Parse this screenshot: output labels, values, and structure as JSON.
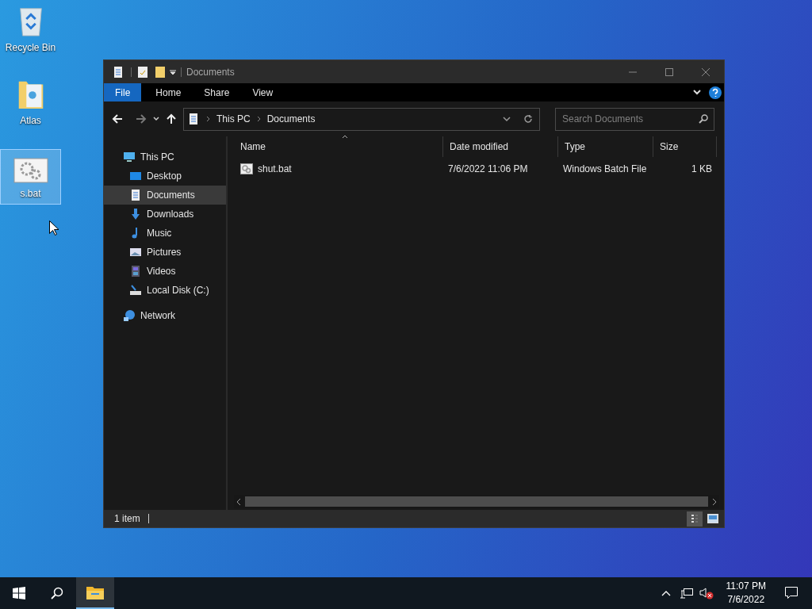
{
  "desktop_icons": [
    {
      "label": "Recycle Bin",
      "kind": "recycle",
      "selected": false
    },
    {
      "label": "Atlas",
      "kind": "folder",
      "selected": false
    },
    {
      "label": "s.bat",
      "kind": "batch",
      "selected": true
    }
  ],
  "window": {
    "title": "Documents",
    "ribbon_tabs": [
      {
        "label": "File",
        "selected": true
      },
      {
        "label": "Home",
        "selected": false
      },
      {
        "label": "Share",
        "selected": false
      },
      {
        "label": "View",
        "selected": false
      }
    ],
    "address": [
      "This PC",
      "Documents"
    ],
    "search": {
      "placeholder": "Search Documents"
    },
    "nav": [
      {
        "label": "This PC",
        "kind": "pc",
        "selected": false,
        "children": [
          {
            "label": "Desktop",
            "kind": "desktop",
            "selected": false
          },
          {
            "label": "Documents",
            "kind": "documents",
            "selected": true
          },
          {
            "label": "Downloads",
            "kind": "downloads",
            "selected": false
          },
          {
            "label": "Music",
            "kind": "music",
            "selected": false
          },
          {
            "label": "Pictures",
            "kind": "pictures",
            "selected": false
          },
          {
            "label": "Videos",
            "kind": "videos",
            "selected": false
          },
          {
            "label": "Local Disk (C:)",
            "kind": "disk",
            "selected": false
          }
        ]
      },
      {
        "label": "Network",
        "kind": "network",
        "selected": false
      }
    ],
    "columns": [
      "Name",
      "Date modified",
      "Type",
      "Size"
    ],
    "rows": [
      {
        "name": "shut.bat",
        "date": "7/6/2022 11:06 PM",
        "type": "Windows Batch File",
        "size": "1 KB"
      }
    ],
    "status": "1 item",
    "view_buttons": [
      {
        "kind": "details",
        "selected": true
      },
      {
        "kind": "large",
        "selected": false
      }
    ]
  },
  "taskbar": {
    "time": "11:07 PM",
    "date": "7/6/2022"
  }
}
